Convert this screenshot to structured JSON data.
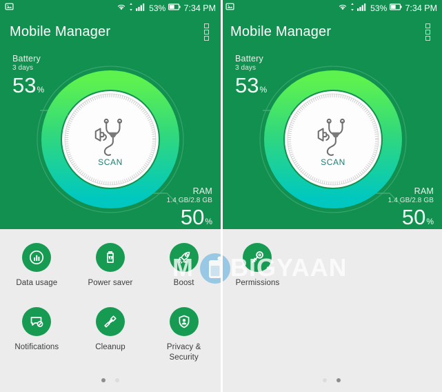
{
  "colors": {
    "header_green": "#12904f",
    "accent_green": "#179b52",
    "gauge_top": "#5ef24f",
    "gauge_bottom": "#00c8c0",
    "body_gray": "#ececec",
    "scan_text": "#1b7f72",
    "watermark_blue": "#8fc4e8"
  },
  "statusbar": {
    "notification_icon": "screenshot-image-icon",
    "wifi_icon": "wifi-icon",
    "data_arrows_icon": "data-transfer-arrows-icon",
    "signal_icon": "cellular-signal-icon",
    "battery_percent": "53%",
    "battery_icon": "battery-icon",
    "time": "7:34 PM"
  },
  "appbar": {
    "title": "Mobile Manager",
    "menu_icon": "overflow-menu-icon"
  },
  "hero": {
    "battery": {
      "label": "Battery",
      "sublabel": "3 days",
      "value": "53",
      "unit": "%"
    },
    "ram": {
      "label": "RAM",
      "sublabel": "1.4 GB/2.8 GB",
      "value": "50",
      "unit": "%"
    },
    "scan": {
      "label": "SCAN",
      "icon": "stethoscope-icon"
    }
  },
  "left_panel": {
    "features": [
      [
        {
          "label": "Data usage",
          "icon": "bar-chart-circle-icon"
        },
        {
          "label": "Power saver",
          "icon": "battery-leaf-icon"
        },
        {
          "label": "Boost",
          "icon": "rocket-icon"
        }
      ],
      [
        {
          "label": "Notifications",
          "icon": "notification-block-icon"
        },
        {
          "label": "Cleanup",
          "icon": "brush-icon"
        },
        {
          "label": "Privacy &\nSecurity",
          "icon": "shield-person-icon"
        }
      ]
    ],
    "page_dots": {
      "count": 2,
      "active": 0
    }
  },
  "right_panel": {
    "features": [
      [
        {
          "label": "Permissions",
          "icon": "key-icon"
        }
      ]
    ],
    "page_dots": {
      "count": 2,
      "active": 1
    }
  },
  "watermark": {
    "text_before": "M",
    "logo": "mobigyaan-phone-logo",
    "text_after": "BIGYAAN"
  }
}
